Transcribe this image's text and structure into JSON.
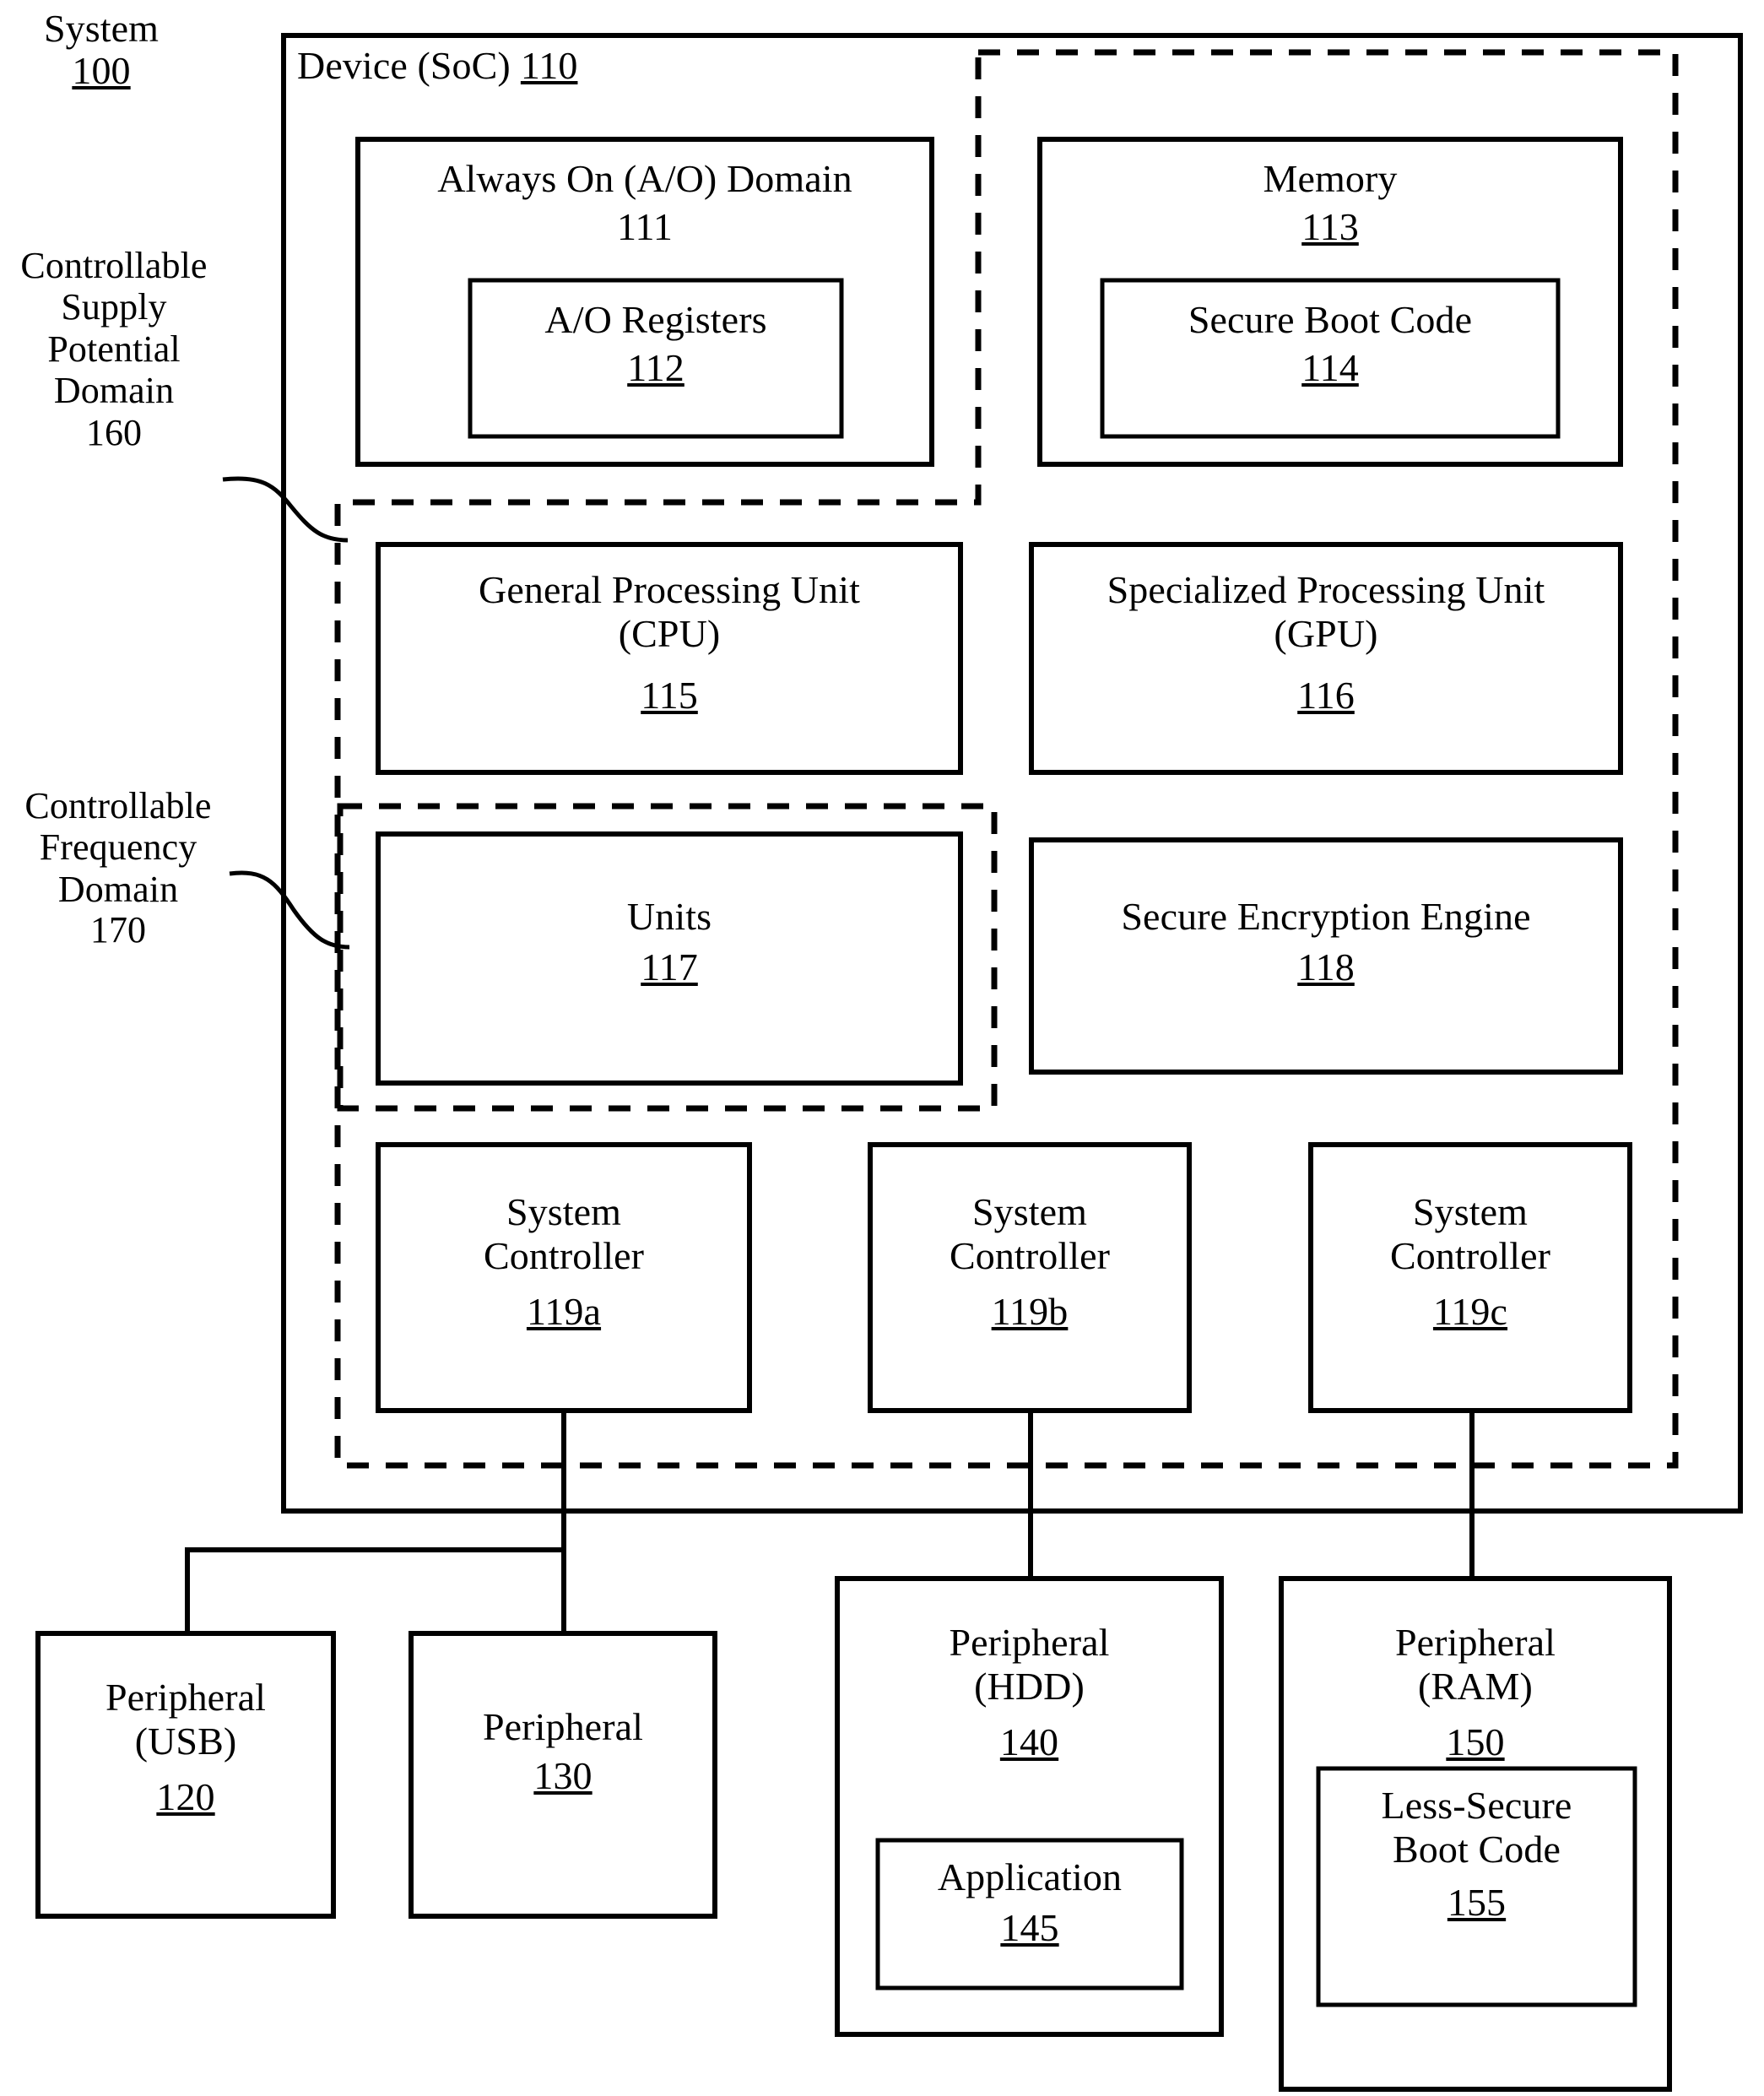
{
  "figure": {
    "type": "patent-block-diagram",
    "system_label": {
      "name": "System",
      "ref": "100"
    },
    "soc_label": {
      "name": "Device (SoC)",
      "ref": "110"
    },
    "domain_callouts": [
      {
        "name": "Controllable\nSupply\nPotential\nDomain",
        "ref": "160",
        "style": "dashed"
      },
      {
        "name": "Controllable\nFrequency\nDomain",
        "ref": "170",
        "style": "dashed"
      }
    ],
    "blocks": [
      {
        "id": "ao_domain",
        "name": "Always On (A/O) Domain",
        "ref": "111",
        "ref_underlined": false
      },
      {
        "id": "ao_regs",
        "name": "A/O Registers",
        "ref": "112",
        "ref_underlined": true
      },
      {
        "id": "memory",
        "name": "Memory",
        "ref": "113",
        "ref_underlined": true
      },
      {
        "id": "secureboot",
        "name": "Secure Boot Code",
        "ref": "114",
        "ref_underlined": true
      },
      {
        "id": "cpu",
        "name": "General Processing Unit\n(CPU)",
        "ref": "115",
        "ref_underlined": true
      },
      {
        "id": "gpu",
        "name": "Specialized Processing Unit\n(GPU)",
        "ref": "116",
        "ref_underlined": true
      },
      {
        "id": "units",
        "name": "Units",
        "ref": "117",
        "ref_underlined": true
      },
      {
        "id": "see",
        "name": "Secure Encryption Engine",
        "ref": "118",
        "ref_underlined": true
      },
      {
        "id": "sysctrl_a",
        "name": "System\nController",
        "ref": "119a",
        "ref_underlined": true
      },
      {
        "id": "sysctrl_b",
        "name": "System\nController",
        "ref": "119b",
        "ref_underlined": true
      },
      {
        "id": "sysctrl_c",
        "name": "System\nController",
        "ref": "119c",
        "ref_underlined": true
      },
      {
        "id": "periph_usb",
        "name": "Peripheral\n(USB)",
        "ref": "120",
        "ref_underlined": true
      },
      {
        "id": "periph_130",
        "name": "Peripheral",
        "ref": "130",
        "ref_underlined": true
      },
      {
        "id": "periph_hdd",
        "name": "Peripheral\n(HDD)",
        "ref": "140",
        "ref_underlined": true
      },
      {
        "id": "application",
        "name": "Application",
        "ref": "145",
        "ref_underlined": true
      },
      {
        "id": "periph_ram",
        "name": "Peripheral\n(RAM)",
        "ref": "150",
        "ref_underlined": true
      },
      {
        "id": "lessboot",
        "name": "Less-Secure\nBoot Code",
        "ref": "155",
        "ref_underlined": true
      }
    ],
    "colors": {
      "stroke": "#000000",
      "background": "#ffffff",
      "text": "#000000"
    }
  }
}
